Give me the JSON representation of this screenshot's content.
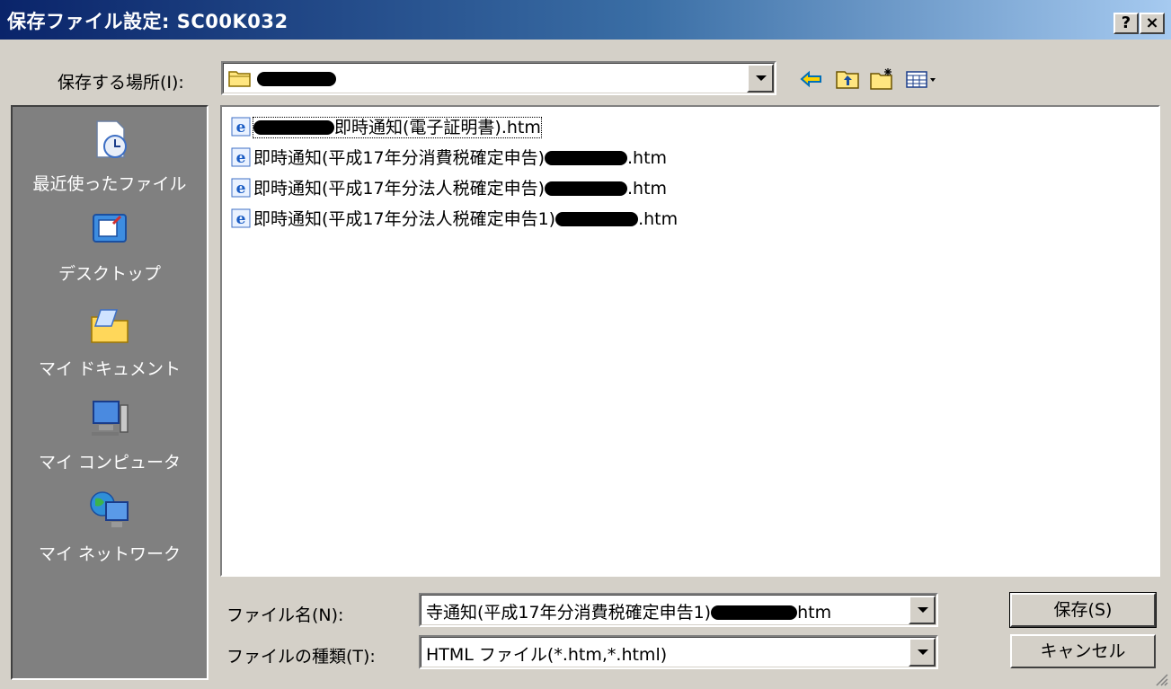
{
  "window": {
    "title": "保存ファイル設定: SC00K032",
    "help_label": "?",
    "close_label": "×"
  },
  "location": {
    "label": "保存する場所(I):",
    "value": ""
  },
  "places": [
    {
      "label": "最近使ったファイル",
      "icon": "recent-docs-icon"
    },
    {
      "label": "デスクトップ",
      "icon": "desktop-icon"
    },
    {
      "label": "マイ ドキュメント",
      "icon": "my-documents-icon"
    },
    {
      "label": "マイ コンピュータ",
      "icon": "my-computer-icon"
    },
    {
      "label": "マイ ネットワーク",
      "icon": "my-network-icon"
    }
  ],
  "files": [
    {
      "pre": "",
      "name": "即時通知(電子証明書)",
      "ext": ".htm",
      "redact_before": true,
      "selected": true
    },
    {
      "pre": "",
      "name": "即時通知(平成17年分消費税確定申告)",
      "ext": ".htm",
      "redact_before": false,
      "selected": false
    },
    {
      "pre": "",
      "name": "即時通知(平成17年分法人税確定申告)",
      "ext": ".htm",
      "redact_before": false,
      "selected": false
    },
    {
      "pre": "",
      "name": "即時通知(平成17年分法人税確定申告1)",
      "ext": ".htm",
      "redact_before": false,
      "selected": false
    }
  ],
  "filename": {
    "label": "ファイル名(N):",
    "value_prefix": "寺通知(平成17年分消費税確定申告1)",
    "value_suffix": "htm"
  },
  "filetype": {
    "label": "ファイルの種類(T):",
    "value": "HTML ファイル(*.htm,*.html)"
  },
  "buttons": {
    "save": "保存(S)",
    "cancel": "キャンセル"
  },
  "colors": {
    "title_start": "#0a246a",
    "title_end": "#a6caf0",
    "face": "#d4d0c8",
    "places_bg": "#808080"
  }
}
